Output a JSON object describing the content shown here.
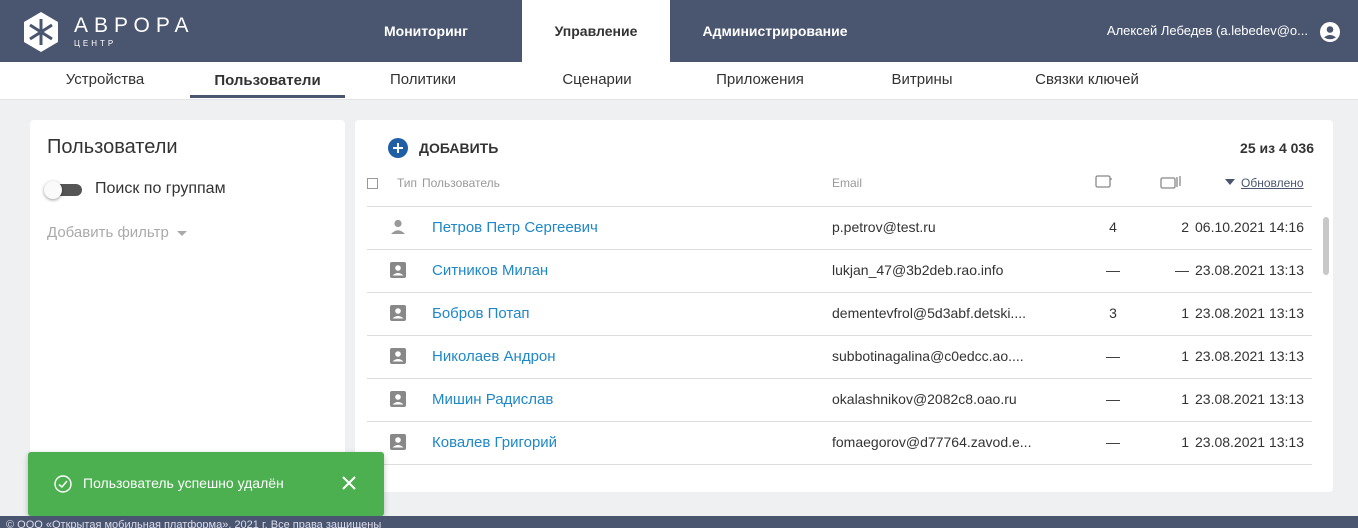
{
  "brand": {
    "name": "АВРОРА",
    "sub": "ЦЕНТР"
  },
  "nav": {
    "tabs": [
      "Мониторинг",
      "Управление",
      "Администрирование"
    ],
    "active_index": 1,
    "user": "Алексей Лебедев (a.lebedev@o..."
  },
  "subnav": {
    "tabs": [
      "Устройства",
      "Пользователи",
      "Политики",
      "Сценарии",
      "Приложения",
      "Витрины",
      "Связки ключей"
    ],
    "active_index": 1
  },
  "left_panel": {
    "title": "Пользователи",
    "toggle_label": "Поиск по группам",
    "toggle_on": false,
    "add_filter": "Добавить фильтр"
  },
  "toolbar": {
    "add_label": "ДОБАВИТЬ",
    "count": "25 из 4 036"
  },
  "table": {
    "headers": {
      "type": "Тип",
      "user": "Пользователь",
      "email": "Email",
      "updated": "Обновлено"
    },
    "rows": [
      {
        "type": "user",
        "name": "Петров Петр Сергеевич",
        "email": "p.petrov@test.ru",
        "c1": "4",
        "c2": "2",
        "date": "06.10.2021 14:16"
      },
      {
        "type": "contact",
        "name": "Ситников Милан",
        "email": "lukjan_47@3b2deb.rao.info",
        "c1": "—",
        "c2": "—",
        "date": "23.08.2021 13:13"
      },
      {
        "type": "contact",
        "name": "Бобров Потап",
        "email": "dementevfrol@5d3abf.detski....",
        "c1": "3",
        "c2": "1",
        "date": "23.08.2021 13:13"
      },
      {
        "type": "contact",
        "name": "Николаев Андрон",
        "email": "subbotinagalina@c0edcc.ao....",
        "c1": "—",
        "c2": "1",
        "date": "23.08.2021 13:13"
      },
      {
        "type": "contact",
        "name": "Мишин Радислав",
        "email": "okalashnikov@2082c8.oao.ru",
        "c1": "—",
        "c2": "1",
        "date": "23.08.2021 13:13"
      },
      {
        "type": "contact",
        "name": "Ковалев Григорий",
        "email": "fomaegorov@d77764.zavod.e...",
        "c1": "—",
        "c2": "1",
        "date": "23.08.2021 13:13"
      }
    ]
  },
  "toast": {
    "message": "Пользователь успешно удалён"
  },
  "footer": {
    "text": "© ООО «Открытая мобильная платформа», 2021 г. Все права защищены"
  },
  "colors": {
    "header": "#4a5670",
    "link": "#1e88c8",
    "toast": "#4caf50",
    "add_icon": "#1f5fa6"
  },
  "icons": [
    "aurora-logo-icon",
    "user-circle-icon",
    "plus-circle-icon",
    "checkbox-icon",
    "phone-icon",
    "tablet-icon",
    "sort-down-icon",
    "person-icon",
    "contact-card-icon",
    "check-circle-icon",
    "close-icon",
    "dropdown-arrow-icon"
  ]
}
